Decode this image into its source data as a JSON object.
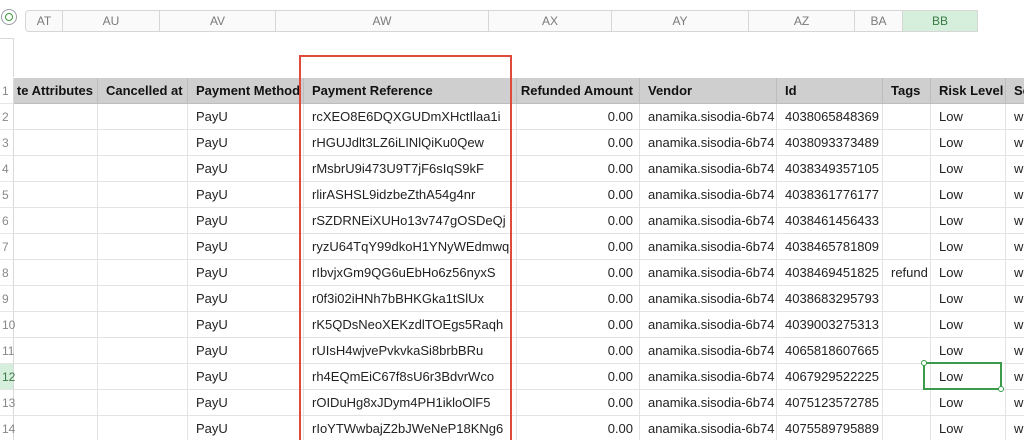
{
  "column_letters": [
    "AT",
    "AU",
    "AV",
    "AW",
    "AX",
    "AY",
    "AZ",
    "BA",
    "BB"
  ],
  "active_column": "BB",
  "headers": {
    "row_number": "1",
    "cols": [
      "te Attributes",
      "Cancelled at",
      "Payment Method",
      "Payment Reference",
      "Refunded Amount",
      "Vendor",
      "Id",
      "Tags",
      "Risk Level",
      "So"
    ]
  },
  "rows": [
    {
      "n": "2",
      "attrs": "",
      "cancelled": "",
      "method": "PayU",
      "ref": "rcXEO8E6DQXGUDmXHctIlaa1i",
      "refund": "0.00",
      "vendor": "anamika.sisodia-6b74",
      "id": "4038065848369",
      "tags": "",
      "risk": "Low",
      "so": "we"
    },
    {
      "n": "3",
      "attrs": "",
      "cancelled": "",
      "method": "PayU",
      "ref": "rHGUJdlt3LZ6iLINlQiKu0Qew",
      "refund": "0.00",
      "vendor": "anamika.sisodia-6b74",
      "id": "4038093373489",
      "tags": "",
      "risk": "Low",
      "so": "we"
    },
    {
      "n": "4",
      "attrs": "",
      "cancelled": "",
      "method": "PayU",
      "ref": "rMsbrU9i473U9T7jF6sIqS9kF",
      "refund": "0.00",
      "vendor": "anamika.sisodia-6b74",
      "id": "4038349357105",
      "tags": "",
      "risk": "Low",
      "so": "we"
    },
    {
      "n": "5",
      "attrs": "",
      "cancelled": "",
      "method": "PayU",
      "ref": "rlirASHSL9idzbeZthA54g4nr",
      "refund": "0.00",
      "vendor": "anamika.sisodia-6b74",
      "id": "4038361776177",
      "tags": "",
      "risk": "Low",
      "so": "we"
    },
    {
      "n": "6",
      "attrs": "",
      "cancelled": "",
      "method": "PayU",
      "ref": "rSZDRNEiXUHo13v747gOSDeQj",
      "refund": "0.00",
      "vendor": "anamika.sisodia-6b74",
      "id": "4038461456433",
      "tags": "",
      "risk": "Low",
      "so": "we"
    },
    {
      "n": "7",
      "attrs": "",
      "cancelled": "",
      "method": "PayU",
      "ref": "ryzU64TqY99dkoH1YNyWEdmwq",
      "refund": "0.00",
      "vendor": "anamika.sisodia-6b74",
      "id": "4038465781809",
      "tags": "",
      "risk": "Low",
      "so": "we"
    },
    {
      "n": "8",
      "attrs": "",
      "cancelled": "",
      "method": "PayU",
      "ref": "rIbvjxGm9QG6uEbHo6z56nyxS",
      "refund": "0.00",
      "vendor": "anamika.sisodia-6b74",
      "id": "4038469451825",
      "tags": "refund",
      "risk": "Low",
      "so": "we"
    },
    {
      "n": "9",
      "attrs": "",
      "cancelled": "",
      "method": "PayU",
      "ref": "r0f3i02iHNh7bBHKGka1tSlUx",
      "refund": "0.00",
      "vendor": "anamika.sisodia-6b74",
      "id": "4038683295793",
      "tags": "",
      "risk": "Low",
      "so": "we"
    },
    {
      "n": "10",
      "attrs": "",
      "cancelled": "",
      "method": "PayU",
      "ref": "rK5QDsNeoXEKzdlTOEgs5Raqh",
      "refund": "0.00",
      "vendor": "anamika.sisodia-6b74",
      "id": "4039003275313",
      "tags": "",
      "risk": "Low",
      "so": "we"
    },
    {
      "n": "11",
      "attrs": "",
      "cancelled": "",
      "method": "PayU",
      "ref": "rUIsH4wjvePvkvkaSi8brbBRu",
      "refund": "0.00",
      "vendor": "anamika.sisodia-6b74",
      "id": "4065818607665",
      "tags": "",
      "risk": "Low",
      "so": "we"
    },
    {
      "n": "12",
      "attrs": "",
      "cancelled": "",
      "method": "PayU",
      "ref": "rh4EQmEiC67f8sU6r3BdvrWco",
      "refund": "0.00",
      "vendor": "anamika.sisodia-6b74",
      "id": "4067929522225",
      "tags": "",
      "risk": "Low",
      "so": "we"
    },
    {
      "n": "13",
      "attrs": "",
      "cancelled": "",
      "method": "PayU",
      "ref": "rOIDuHg8xJDym4PH1ikloOlF5",
      "refund": "0.00",
      "vendor": "anamika.sisodia-6b74",
      "id": "4075123572785",
      "tags": "",
      "risk": "Low",
      "so": "we"
    },
    {
      "n": "14",
      "attrs": "",
      "cancelled": "",
      "method": "PayU",
      "ref": "rIoYTWwbajZ2bJWeNeP18KNg6",
      "refund": "0.00",
      "vendor": "anamika.sisodia-6b74",
      "id": "4075589795889",
      "tags": "",
      "risk": "Low",
      "so": "we"
    }
  ],
  "active_row": "12",
  "colors": {
    "highlight": "#e04a3a",
    "selection": "#3a9c4a",
    "header_bg": "#cfcfcf"
  }
}
